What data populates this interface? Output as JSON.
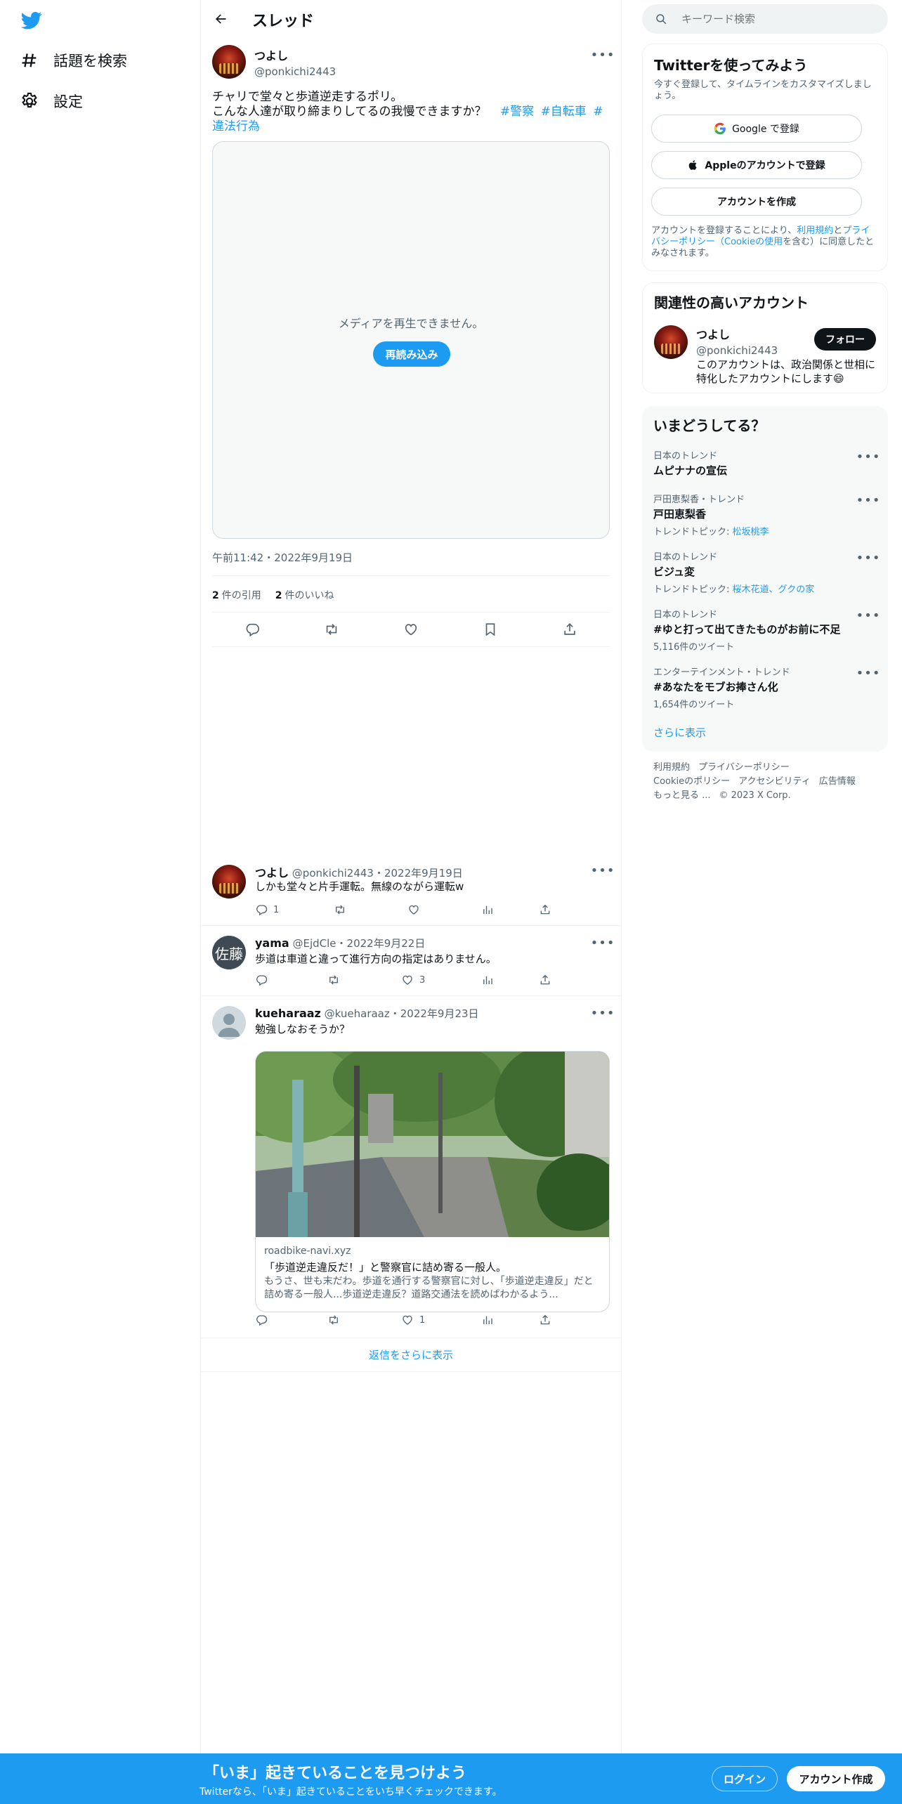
{
  "nav": {
    "explore_label": "話題を検索",
    "settings_label": "設定"
  },
  "header": {
    "title": "スレッド"
  },
  "tweet": {
    "name": "つよし",
    "handle": "@ponkichi2443",
    "text_line1": "チャリで堂々と歩道逆走するポリ。",
    "text_line2": "こんな人達が取り締まりしてるの我慢できますか？",
    "hashtags": [
      "#警察",
      "#自転車",
      "#違法行為"
    ],
    "media_message": "メディアを再生できません。",
    "reload_label": "再読み込み",
    "timestamp": "午前11:42・2022年9月19日",
    "quotes_count": "2",
    "quotes_label": "件の引用",
    "likes_count": "2",
    "likes_label": "件のいいね"
  },
  "replies": [
    {
      "name": "つよし",
      "handle": "@ponkichi2443",
      "date": "・2022年9月19日",
      "text": "しかも堂々と片手運転。無線のながら運転w",
      "reply_count": "1",
      "retweet_count": "",
      "like_count": ""
    },
    {
      "name": "yama",
      "handle": "@EjdCle",
      "date": "・2022年9月22日",
      "avatar_text": "佐藤",
      "text": "歩道は車道と違って進行方向の指定はありません。",
      "reply_count": "",
      "retweet_count": "",
      "like_count": "3"
    },
    {
      "name": "kueharaaz",
      "handle": "@kueharaaz",
      "date": "・2022年9月23日",
      "text": "勉強しなおそうか？",
      "reply_count": "",
      "retweet_count": "",
      "like_count": "1",
      "card": {
        "site": "roadbike-navi.xyz",
        "title": "「歩道逆走違反だ！」と警察官に詰め寄る一般人。",
        "description": "もうさ、世も末だわ。歩道を通行する警察官に対し、「歩道逆走違反」だと詰め寄る一般人...歩道逆走違反？道路交通法を読めばわかるよう..."
      }
    }
  ],
  "more_replies_label": "返信をさらに表示",
  "search": {
    "placeholder": "キーワード検索"
  },
  "signup_panel": {
    "title": "Twitterを使ってみよう",
    "subtitle": "今すぐ登録して、タイムラインをカスタマイズしましょう。",
    "google_label": "Google で登録",
    "apple_label": "Appleのアカウントで登録",
    "create_label": "アカウントを作成",
    "legal_prefix": "アカウントを登録することにより、",
    "legal_terms": "利用規約",
    "legal_and": "と",
    "legal_privacy": "プライバシーポリシー（Cookieの使用",
    "legal_suffix": "を含む）に同意したとみなされます。"
  },
  "related_panel": {
    "title": "関連性の高いアカウント",
    "name": "つよし",
    "handle": "@ponkichi2443",
    "follow_label": "フォロー",
    "bio": "このアカウントは、政治関係と世相に特化したアカウントにします😄"
  },
  "trends_panel": {
    "title": "いまどうしてる？",
    "show_more": "さらに表示",
    "items": [
      {
        "meta": "日本のトレンド",
        "name": "ムピナナの宣伝",
        "extra_prefix": "",
        "extra_links": "",
        "count": ""
      },
      {
        "meta": "戸田恵梨香・トレンド",
        "name": "戸田恵梨香",
        "extra_prefix": "トレンドトピック: ",
        "extra_links": "松坂桃李",
        "count": ""
      },
      {
        "meta": "日本のトレンド",
        "name": "ビジュ変",
        "extra_prefix": "トレンドトピック: ",
        "extra_links": "桜木花道、グクの家",
        "count": ""
      },
      {
        "meta": "日本のトレンド",
        "name": "#ゆと打って出てきたものがお前に不足",
        "extra_prefix": "",
        "extra_links": "",
        "count": "5,116件のツイート"
      },
      {
        "meta": "エンターテインメント・トレンド",
        "name": "#あなたをモブお捧さん化",
        "extra_prefix": "",
        "extra_links": "",
        "count": "1,654件のツイート"
      }
    ]
  },
  "footer": {
    "terms": "利用規約",
    "privacy": "プライバシーポリシー",
    "cookie": "Cookieのポリシー",
    "accessibility": "アクセシビリティ",
    "ads": "広告情報",
    "more": "もっと見る ...",
    "copyright": "© 2023 X Corp."
  },
  "bottombar": {
    "title": "「いま」起きていることを見つけよう",
    "subtitle": "Twitterなら、「いま」起きていることをいち早くチェックできます。",
    "login_label": "ログイン",
    "create_label": "アカウント作成"
  },
  "colors": {
    "accent": "#1d9bf0",
    "text": "#0f1419",
    "secondary": "#536471",
    "border": "#eff3f4"
  }
}
